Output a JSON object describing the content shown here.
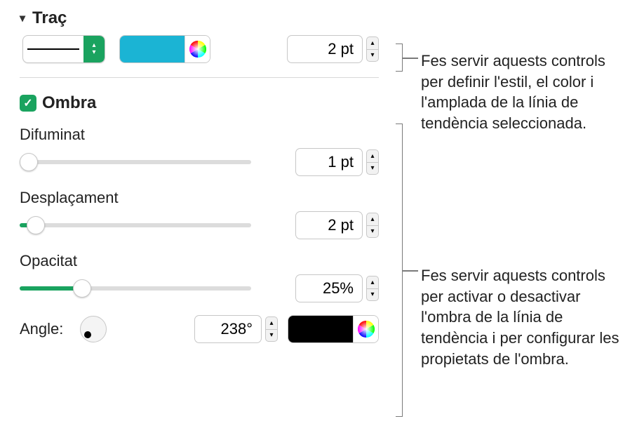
{
  "stroke": {
    "title": "Traç",
    "width_value": "2 pt",
    "color_swatch": "#1bb4d4"
  },
  "shadow": {
    "checkbox_label": "Ombra",
    "checked": true,
    "blur": {
      "label": "Difuminat",
      "value": "1 pt",
      "percent": 4
    },
    "offset": {
      "label": "Desplaçament",
      "value": "2 pt",
      "percent": 7
    },
    "opacity": {
      "label": "Opacitat",
      "value": "25%",
      "percent": 27
    },
    "angle": {
      "label": "Angle:",
      "value": "238°"
    },
    "color_swatch": "#000000"
  },
  "callouts": {
    "stroke_note": "Fes servir aquests controls per definir l'estil, el color i l'amplada de la línia de tendència seleccionada.",
    "shadow_note": "Fes servir aquests controls per activar o desactivar l'ombra de la línia de tendència i per configurar les propietats de l'ombra."
  }
}
